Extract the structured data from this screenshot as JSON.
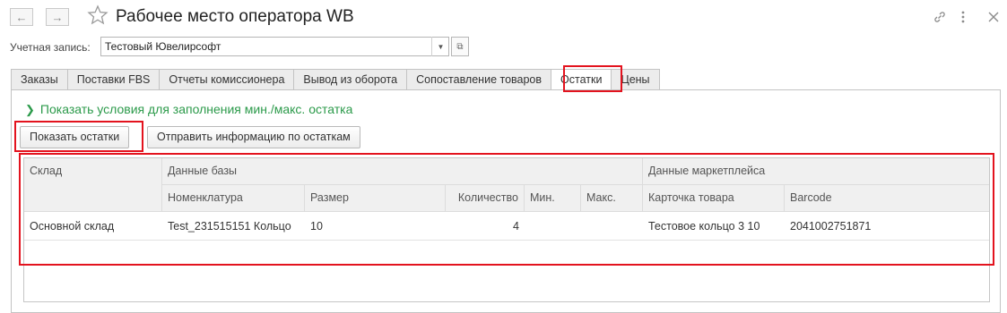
{
  "window": {
    "title": "Рабочее место оператора WB",
    "back_icon": "arrow-left-icon",
    "forward_icon": "arrow-right-icon",
    "favorite_icon": "star-icon",
    "link_icon": "link-icon",
    "more_icon": "more-vertical-icon",
    "close_icon": "close-icon"
  },
  "account": {
    "label": "Учетная запись:",
    "value": "Тестовый Ювелирсофт"
  },
  "tabs": [
    {
      "label": "Заказы",
      "active": false
    },
    {
      "label": "Поставки FBS",
      "active": false
    },
    {
      "label": "Отчеты комиссионера",
      "active": false
    },
    {
      "label": "Вывод из оборота",
      "active": false
    },
    {
      "label": "Сопоставление товаров",
      "active": false
    },
    {
      "label": "Остатки",
      "active": true
    },
    {
      "label": "Цены",
      "active": false
    }
  ],
  "panel": {
    "conditions_link": "Показать условия для заполнения мин./макс. остатка",
    "show_stock_button": "Показать остатки",
    "send_stock_button": "Отправить информацию по остаткам"
  },
  "table": {
    "group_headers": {
      "warehouse": "Склад",
      "base": "Данные базы",
      "marketplace": "Данные маркетплейса"
    },
    "columns": {
      "nomenclature": "Номенклатура",
      "size": "Размер",
      "quantity": "Количество",
      "min": "Мин.",
      "max": "Макс.",
      "card": "Карточка товара",
      "barcode": "Barcode"
    },
    "rows": [
      {
        "warehouse": "Основной склад",
        "nomenclature": "Test_231515151 Кольцо",
        "size": "10",
        "quantity": "4",
        "min": "",
        "max": "",
        "card": "Тестовое кольцо 3 10",
        "barcode": "2041002751871"
      }
    ]
  },
  "colors": {
    "highlight": "#e3131e",
    "link_green": "#2b9a4a"
  }
}
